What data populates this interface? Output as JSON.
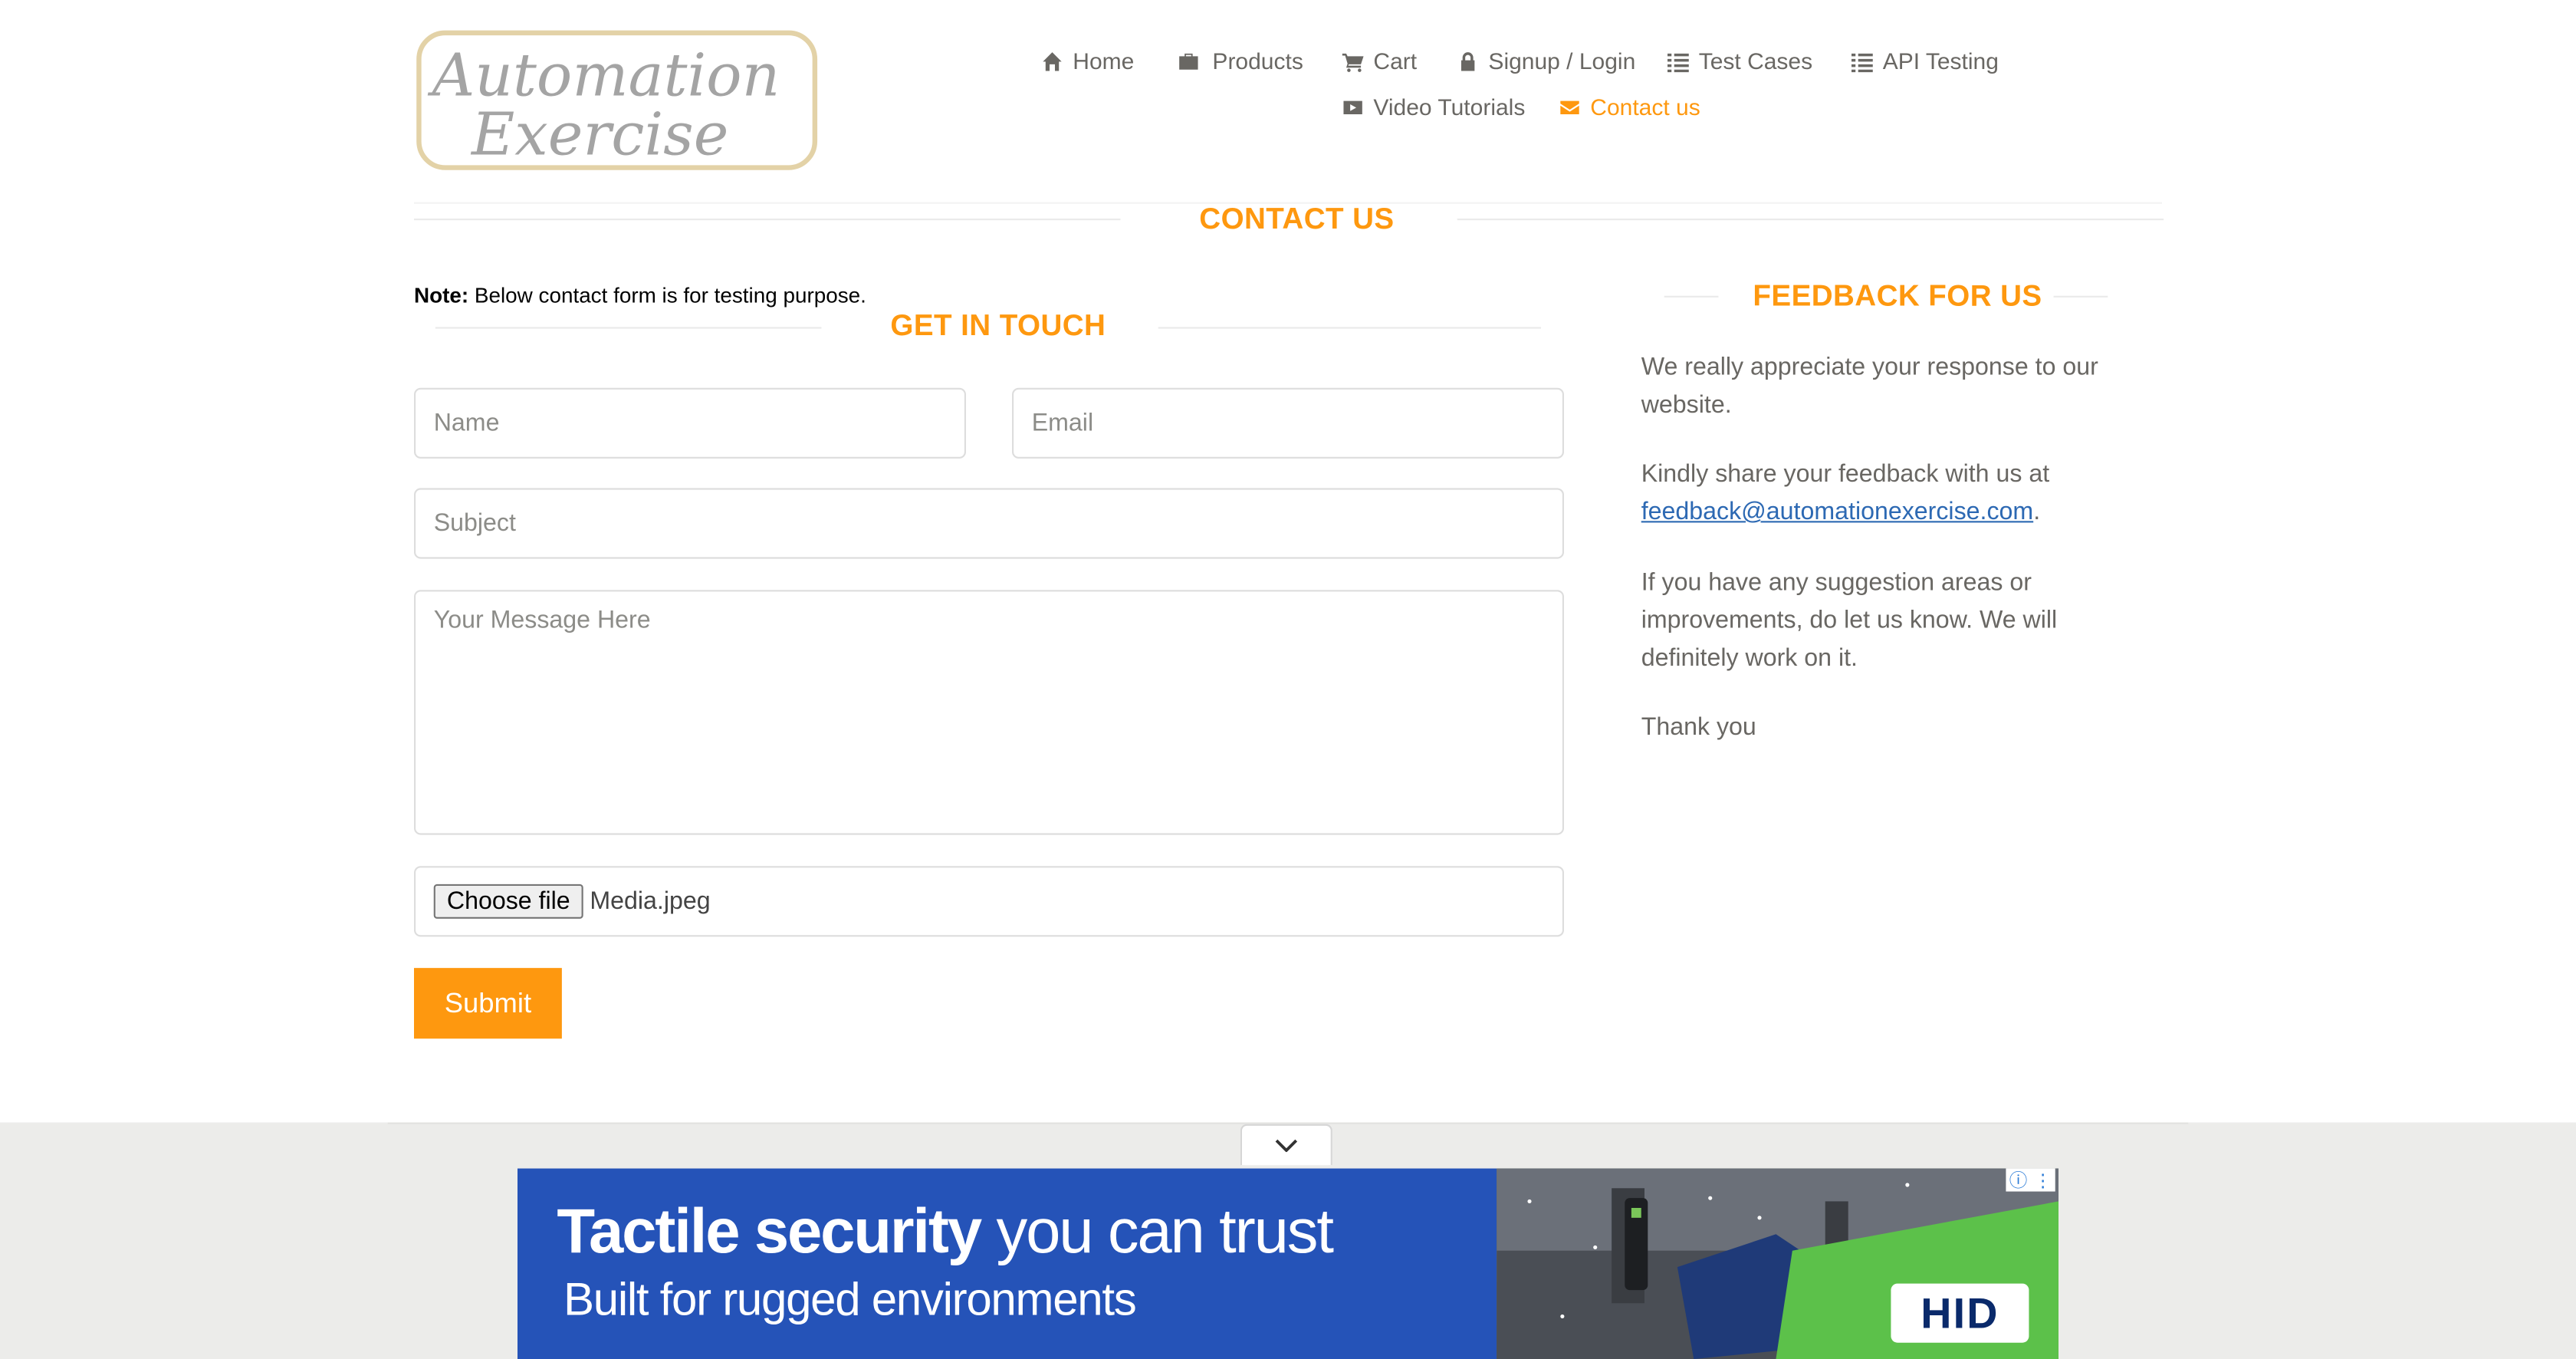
{
  "brand": {
    "logo_line1": "Automation",
    "logo_line2": "Exercise"
  },
  "nav": {
    "items": [
      {
        "label": "Home",
        "icon": "home-icon"
      },
      {
        "label": "Products",
        "icon": "briefcase-icon"
      },
      {
        "label": "Cart",
        "icon": "shopping-cart-icon"
      },
      {
        "label": "Signup / Login",
        "icon": "lock-icon"
      },
      {
        "label": "Test Cases",
        "icon": "list-icon"
      },
      {
        "label": "API Testing",
        "icon": "list-icon"
      },
      {
        "label": "Video Tutorials",
        "icon": "youtube-play-icon"
      },
      {
        "label": "Contact us",
        "icon": "envelope-icon",
        "active": true
      }
    ],
    "active_color": "#FE980F"
  },
  "page": {
    "title": "CONTACT US"
  },
  "form": {
    "note_bold": "Note:",
    "note_text": " Below contact form is for testing purpose.",
    "title": "GET IN TOUCH",
    "name_placeholder": "Name",
    "email_placeholder": "Email",
    "subject_placeholder": "Subject",
    "message_placeholder": "Your Message Here",
    "file_button": "Choose file",
    "file_name": "Media.jpeg",
    "submit_label": "Submit"
  },
  "feedback": {
    "title": "FEEDBACK FOR US",
    "p1": "We really appreciate your response to our website.",
    "p2_prefix": "Kindly share your feedback with us at ",
    "p2_link": "feedback@automationexercise.com",
    "p2_suffix": ".",
    "p3": "If you have any suggestion areas or improvements, do let us know. We will definitely work on it.",
    "p4": "Thank you"
  },
  "ad": {
    "headline_bold": "Tactile security",
    "headline_rest": " you can trust",
    "subline": "Built for rugged environments",
    "brand": "HID",
    "info_glyph": "ⓘ",
    "menu_glyph": "⋮"
  },
  "colors": {
    "accent": "#FE980F",
    "text": "#696763",
    "link": "#2d69b3",
    "ad_blue": "#2553b8"
  }
}
